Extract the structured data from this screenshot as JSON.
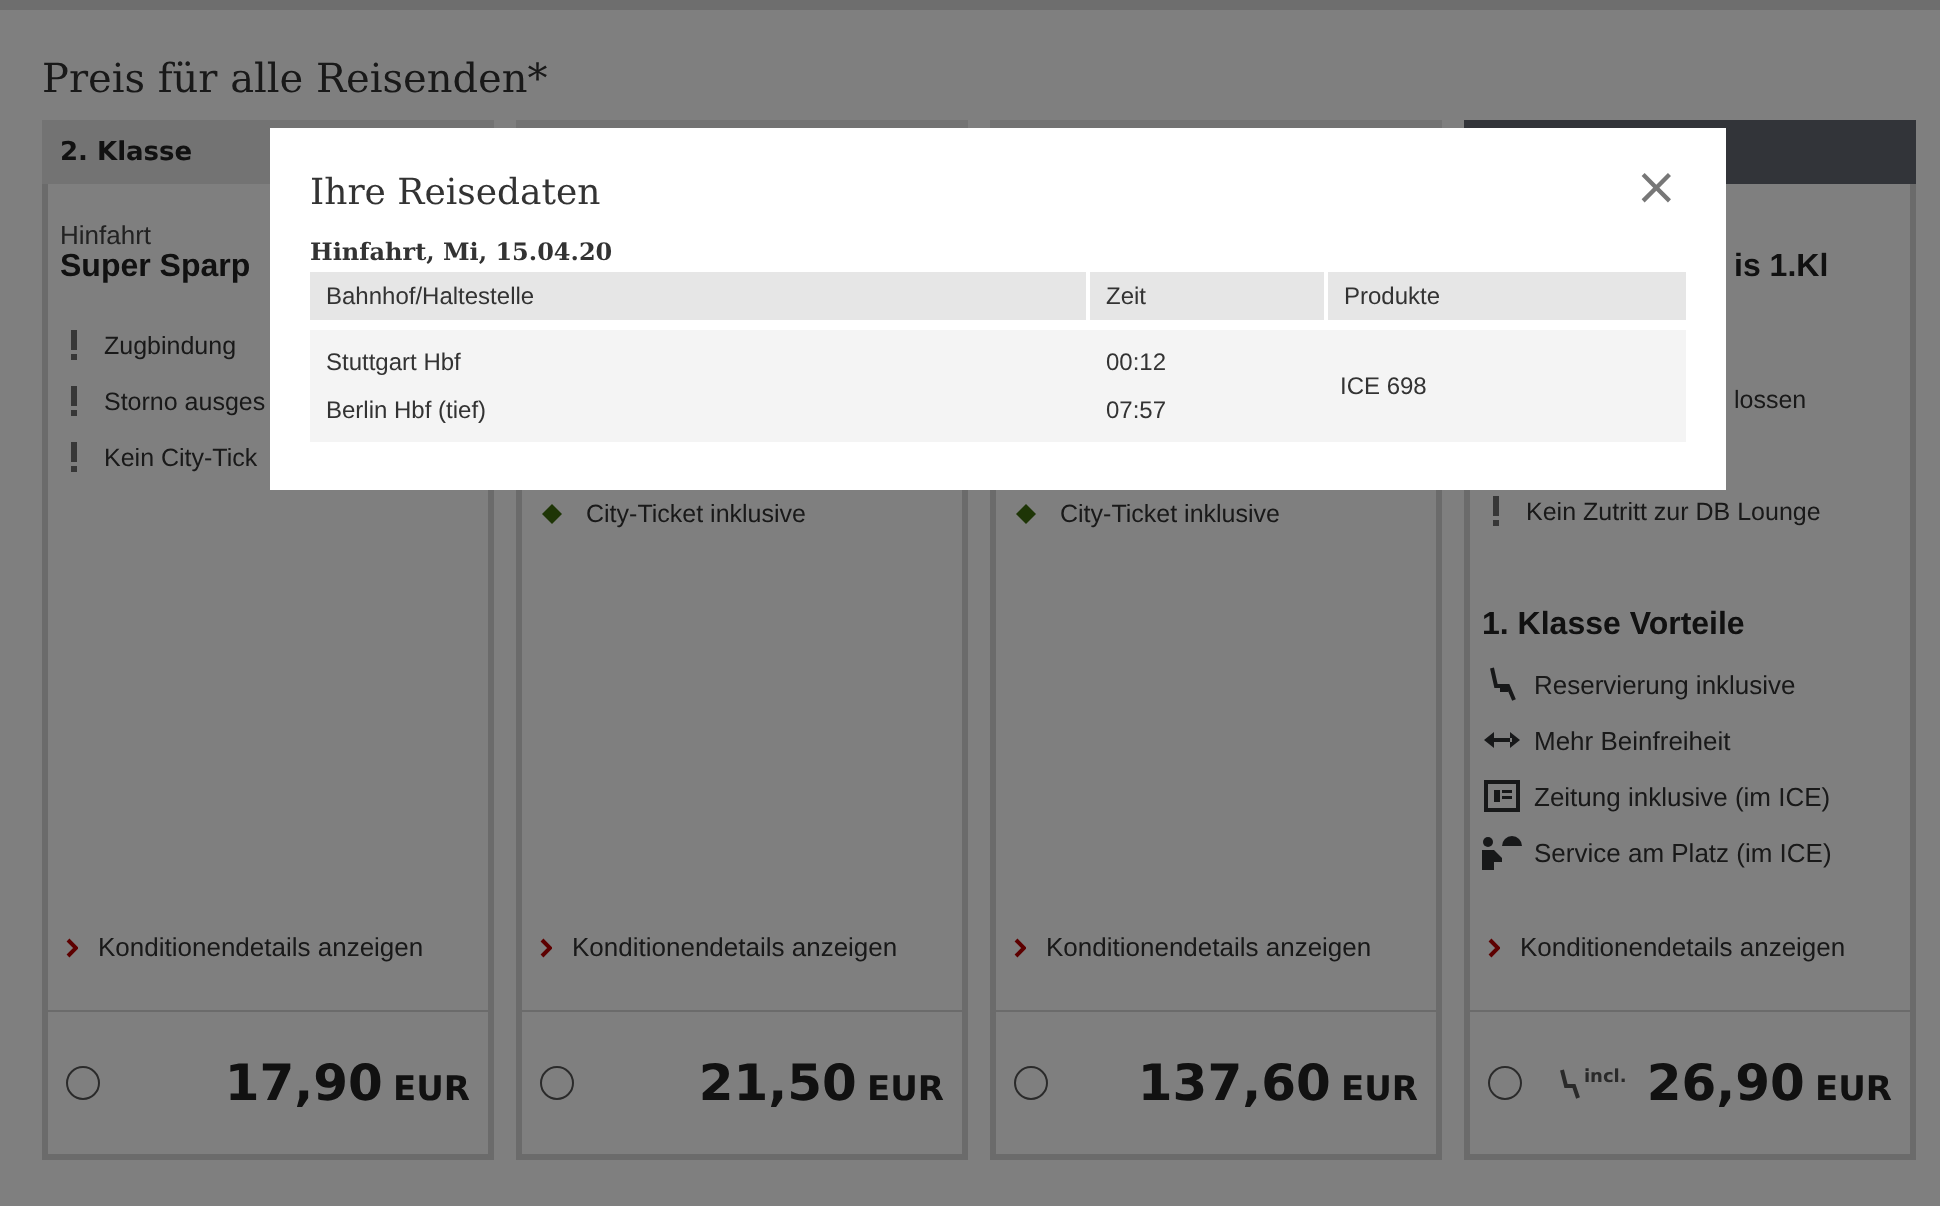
{
  "page_title": "Preis für alle Reisenden*",
  "cards": [
    {
      "header": "2. Klasse",
      "highlighted": false,
      "label": "Hinfahrt",
      "title": "Super Sparp",
      "features": [
        {
          "kind": "warn",
          "text": "Zugbindung"
        },
        {
          "kind": "warn",
          "text": "Storno ausges"
        },
        {
          "kind": "warn",
          "text": "Kein City-Tick"
        }
      ],
      "link": "Konditionendetails anzeigen",
      "price": "17,90",
      "currency": "EUR",
      "selected": false
    },
    {
      "highlighted": false,
      "features": [
        {
          "kind": "check",
          "text": "City-Ticket inklusive"
        }
      ],
      "link": "Konditionendetails anzeigen",
      "price": "21,50",
      "currency": "EUR",
      "selected": false
    },
    {
      "highlighted": false,
      "features": [
        {
          "kind": "check",
          "text": "City-Ticket inklusive"
        }
      ],
      "link": "Konditionendetails anzeigen",
      "price": "137,60",
      "currency": "EUR",
      "selected": false
    },
    {
      "highlighted": true,
      "title": "is 1.Kl",
      "title_cut_left": true,
      "features": [
        {
          "text": "lossen",
          "cut_left": true
        },
        {
          "kind": "warn",
          "text": "Kein Zutritt zur DB Lounge"
        }
      ],
      "perks_title": "1. Klasse Vorteile",
      "perks": [
        {
          "kind": "seat",
          "text": "Reservierung inklusive"
        },
        {
          "kind": "legroom",
          "text": "Mehr Beinfreiheit"
        },
        {
          "kind": "newspaper",
          "text": "Zeitung inklusive (im ICE)"
        },
        {
          "kind": "service",
          "text": "Service am Platz (im ICE)"
        }
      ],
      "link": "Konditionendetails anzeigen",
      "badge": "incl.",
      "price": "26,90",
      "currency": "EUR",
      "selected": false
    }
  ],
  "dialog": {
    "title": "Ihre Reisedaten",
    "close": "×",
    "section": "Hinfahrt, Mi, 15.04.20",
    "columns": [
      "Bahnhof/Haltestelle",
      "Zeit",
      "Produkte"
    ],
    "rows": [
      {
        "stations": [
          "Stuttgart Hbf",
          "Berlin Hbf (tief)"
        ],
        "times": [
          "00:12",
          "07:57"
        ],
        "product": "ICE 698"
      }
    ]
  }
}
